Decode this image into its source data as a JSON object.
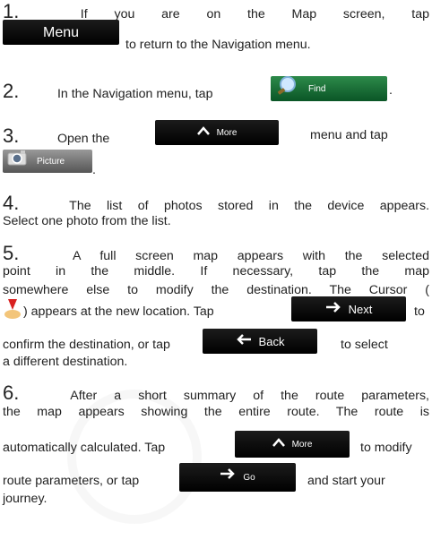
{
  "steps": [
    {
      "num": "1.",
      "a": "If you are on the Map screen, tap",
      "b": "to return to the Navigation menu."
    },
    {
      "num": "2.",
      "a": "In the Navigation menu, tap",
      "b": "."
    },
    {
      "num": "3.",
      "a": "Open the",
      "b": "menu and tap",
      "c": "."
    },
    {
      "num": "4.",
      "a": "The list of photos stored in the device appears.",
      "b": "Select one photo from the list."
    },
    {
      "num": "5.",
      "a": "A full screen map appears with the selected",
      "b": "point in the middle. If necessary, tap the map",
      "c": "somewhere else to modify the destination. The Cursor (",
      "d": ") appears at the new location. Tap",
      "e": "to",
      "f": "confirm the destination, or tap",
      "g": "to select",
      "h": "a different destination."
    },
    {
      "num": "6.",
      "a": "After a short summary of the route parameters,",
      "b": "the map appears showing the entire route. The route is",
      "c": "automatically calculated. Tap",
      "d": "to modify",
      "e": "route parameters, or tap",
      "f": "and start your",
      "g": "journey."
    }
  ],
  "buttons": {
    "menu": "Menu",
    "find": "Find",
    "more": "More",
    "picture": "Picture",
    "next": "Next",
    "back": "Back",
    "go": "Go"
  },
  "colors": {
    "button_dark": "#111111",
    "button_green": "#1b6e36",
    "text": "#222222"
  }
}
